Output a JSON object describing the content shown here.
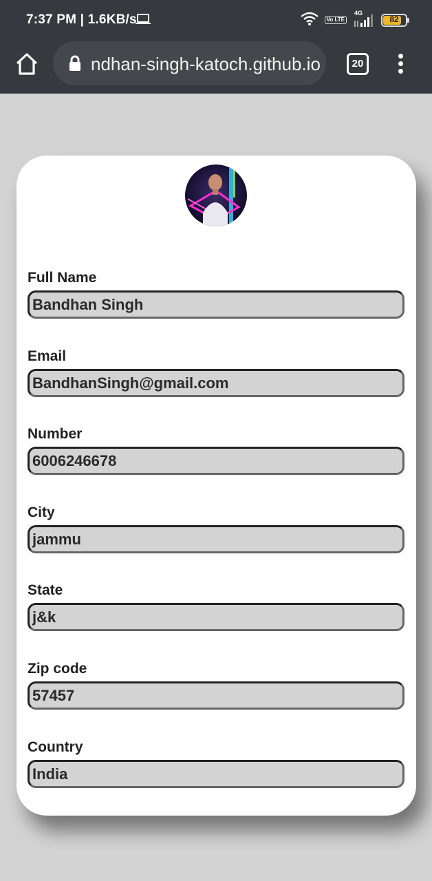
{
  "status_bar": {
    "time_speed": "7:37 PM | 1.6KB/s",
    "battery": "82",
    "battery_level": 0.82,
    "network_type": "4G",
    "volte_label": "Vo LTE"
  },
  "browser": {
    "url": "ndhan-singh-katoch.github.io",
    "tab_count": "20"
  },
  "profile": {
    "avatar": "avatar-icon"
  },
  "fields": [
    {
      "label": "Full Name",
      "value": "Bandhan Singh"
    },
    {
      "label": "Email",
      "value": "BandhanSingh@gmail.com"
    },
    {
      "label": "Number",
      "value": "6006246678"
    },
    {
      "label": "City",
      "value": "jammu"
    },
    {
      "label": "State",
      "value": "j&k"
    },
    {
      "label": "Zip code",
      "value": "57457"
    },
    {
      "label": "Country",
      "value": "India"
    }
  ],
  "colors": {
    "background": "#d3d3d3",
    "browser_chrome": "#36393d",
    "card": "#ffffff",
    "input_fill": "#d3d3d3",
    "battery": "#f0b429"
  }
}
